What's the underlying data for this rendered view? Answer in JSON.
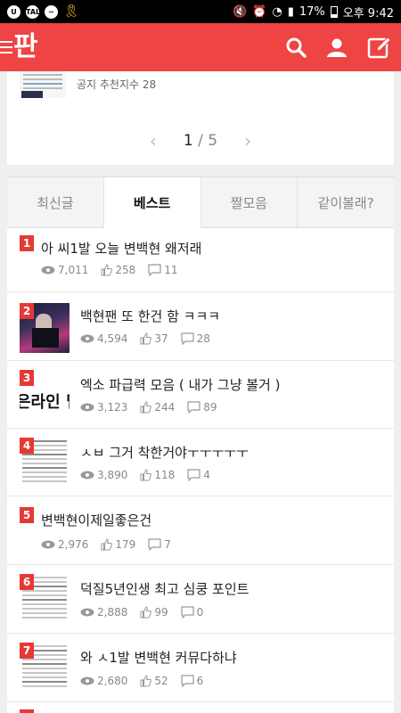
{
  "status_bar": {
    "battery": "17%",
    "time": "오후 9:42",
    "left_icons": [
      "app-icon",
      "talk-icon",
      "messenger-icon",
      "ribbon-icon"
    ],
    "right_icons": [
      "mute-icon",
      "alarm-icon",
      "wifi-icon",
      "signal-icon",
      "battery-icon"
    ]
  },
  "app_bar": {
    "logo_text": "판",
    "accent_color": "#ee4444",
    "actions": [
      "search-icon",
      "profile-icon",
      "write-icon"
    ]
  },
  "top_card": {
    "caption": "공지 추천지수 28",
    "pager": {
      "current": "1",
      "separator": "/",
      "total": "5",
      "prev": "‹",
      "next": "›"
    }
  },
  "tabs": [
    {
      "label": "최신글",
      "active": false
    },
    {
      "label": "베스트",
      "active": true
    },
    {
      "label": "짤모음",
      "active": false
    },
    {
      "label": "같이볼래?",
      "active": false
    }
  ],
  "posts": [
    {
      "rank": "1",
      "title": "아 씨1발 오늘 변백현 왜저래",
      "views": "7,011",
      "likes": "258",
      "comments": "11",
      "thumb": "none"
    },
    {
      "rank": "2",
      "title": "백현팬 또 한건 함 ㅋㅋㅋ",
      "views": "4,594",
      "likes": "37",
      "comments": "28",
      "thumb": "photo"
    },
    {
      "rank": "3",
      "title": "엑소 파급력 모음 ( 내가 그냥 볼거 )",
      "views": "3,123",
      "likes": "244",
      "comments": "89",
      "thumb": "text",
      "thumb_text": "은라인 딥"
    },
    {
      "rank": "4",
      "title": "ㅅㅂ 그거 착한거야ㅜㅜㅜㅜㅜ",
      "views": "3,890",
      "likes": "118",
      "comments": "4",
      "thumb": "doc"
    },
    {
      "rank": "5",
      "title": "변백현이제일좋은건",
      "views": "2,976",
      "likes": "179",
      "comments": "7",
      "thumb": "none"
    },
    {
      "rank": "6",
      "title": "덕질5년인생 최고 심쿵 포인트",
      "views": "2,888",
      "likes": "99",
      "comments": "0",
      "thumb": "doc"
    },
    {
      "rank": "7",
      "title": "와 ㅅ1발 변백현 커뮤다하냐",
      "views": "2,680",
      "likes": "52",
      "comments": "6",
      "thumb": "doc"
    }
  ]
}
